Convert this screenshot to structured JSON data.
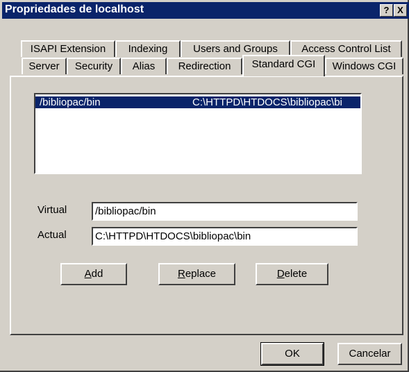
{
  "window": {
    "title": "Propriedades de localhost",
    "help_glyph": "?",
    "close_glyph": "X"
  },
  "tabs_back": [
    "ISAPI Extension",
    "Indexing",
    "Users and Groups",
    "Access Control List"
  ],
  "tabs_front": [
    "Server",
    "Security",
    "Alias",
    "Redirection",
    "Standard CGI",
    "Windows CGI"
  ],
  "active_tab": "Standard CGI",
  "cgi_list": [
    {
      "virtual": "/bibliopac/bin",
      "actual": "C:\\HTTPD\\HTDOCS\\bibliopac\\bi",
      "selected": true
    }
  ],
  "form": {
    "virtual_label": "Virtual",
    "virtual_value": "/bibliopac/bin",
    "actual_label": "Actual",
    "actual_value": "C:\\HTTPD\\HTDOCS\\bibliopac\\bin"
  },
  "buttons": {
    "add_key": "A",
    "add_rest": "dd",
    "replace_key": "R",
    "replace_rest": "eplace",
    "delete_key": "D",
    "delete_rest": "elete",
    "ok": "OK",
    "cancel": "Cancelar"
  },
  "colors": {
    "face": "#d4d0c8",
    "titlebar": "#0a246a",
    "selection": "#0a246a"
  }
}
